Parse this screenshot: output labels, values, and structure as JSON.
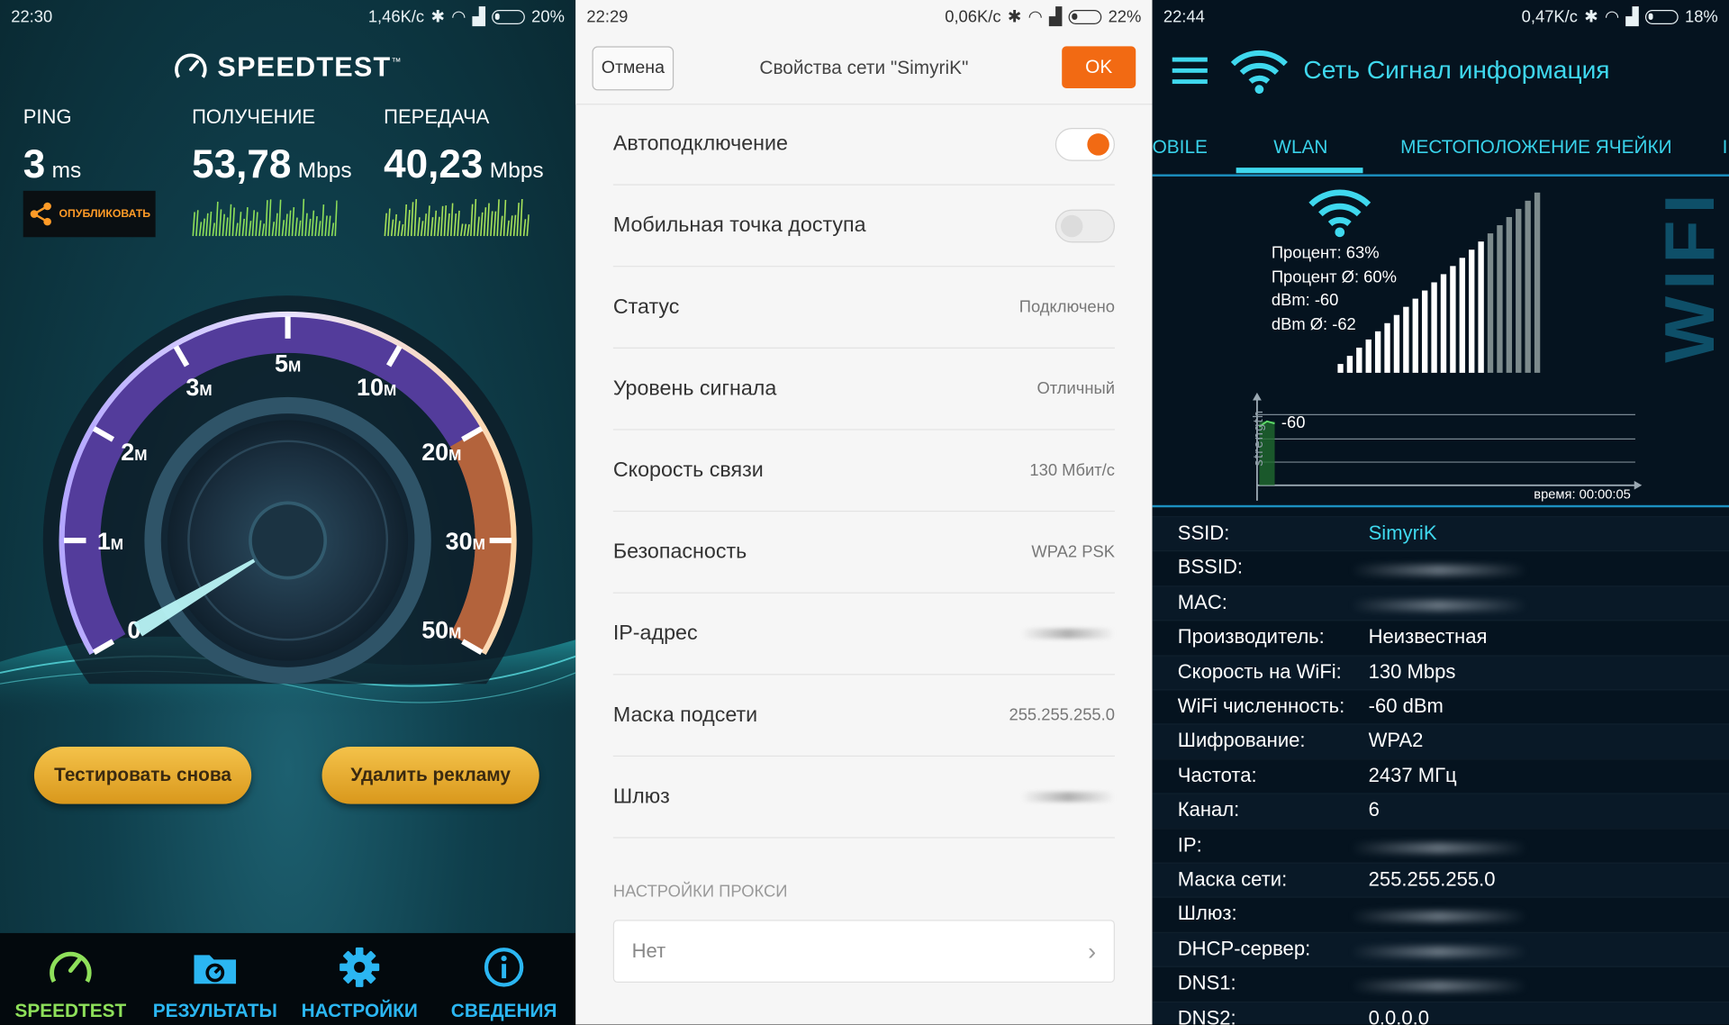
{
  "speedtest": {
    "status": {
      "time": "22:30",
      "speed": "1,46K/с",
      "battery": "20%",
      "battery_level": 0.2
    },
    "logo": "SPEEDTEST",
    "logo_tm": "™",
    "ping": {
      "label": "PING",
      "value": "3",
      "unit": "ms"
    },
    "download": {
      "label": "ПОЛУЧЕНИЕ",
      "value": "53,78",
      "unit": "Mbps"
    },
    "upload": {
      "label": "ПЕРЕДАЧА",
      "value": "40,23",
      "unit": "Mbps"
    },
    "share_label": "ОПУБЛИКОВАТЬ",
    "gauge_ticks": [
      {
        "num": "0",
        "unit": ""
      },
      {
        "num": "1",
        "unit": "M"
      },
      {
        "num": "2",
        "unit": "M"
      },
      {
        "num": "3",
        "unit": "M"
      },
      {
        "num": "5",
        "unit": "M"
      },
      {
        "num": "10",
        "unit": "M"
      },
      {
        "num": "20",
        "unit": "M"
      },
      {
        "num": "30",
        "unit": "M"
      },
      {
        "num": "50",
        "unit": "M"
      }
    ],
    "btn_retest": "Тестировать снова",
    "btn_remove_ads": "Удалить рекламу",
    "nav": [
      {
        "label": "SPEEDTEST",
        "color": "#8ee05a",
        "icon": "speedometer-icon"
      },
      {
        "label": "РЕЗУЛЬТАТЫ",
        "color": "#2bb6f2",
        "icon": "folder-icon"
      },
      {
        "label": "НАСТРОЙКИ",
        "color": "#2bb6f2",
        "icon": "gear-icon"
      },
      {
        "label": "СВЕДЕНИЯ",
        "color": "#2bb6f2",
        "icon": "info-icon"
      }
    ],
    "colors": {
      "accent_green": "#8ee05a",
      "accent_blue": "#2bb6f2",
      "button_gold": "#e6ad33"
    }
  },
  "network_props": {
    "status": {
      "time": "22:29",
      "speed": "0,06K/с",
      "battery": "22%",
      "battery_level": 0.22
    },
    "cancel": "Отмена",
    "title": "Свойства сети \"SimyriK\"",
    "ok": "OK",
    "rows": [
      {
        "label": "Автоподключение",
        "toggle": true
      },
      {
        "label": "Мобильная точка доступа",
        "toggle": false
      },
      {
        "label": "Статус",
        "value": "Подключено"
      },
      {
        "label": "Уровень сигнала",
        "value": "Отличный"
      },
      {
        "label": "Скорость связи",
        "value": "130 Мбит/с"
      },
      {
        "label": "Безопасность",
        "value": "WPA2 PSK"
      },
      {
        "label": "IP-адрес",
        "blurred": true
      },
      {
        "label": "Маска подсети",
        "value": "255.255.255.0"
      },
      {
        "label": "Шлюз",
        "blurred": true
      }
    ],
    "proxy_section": "НАСТРОЙКИ ПРОКСИ",
    "proxy_value": "Нет",
    "colors": {
      "accent": "#f26a13"
    }
  },
  "signal_info": {
    "status": {
      "time": "22:44",
      "speed": "0,47K/с",
      "battery": "18%",
      "battery_level": 0.18
    },
    "title": "Сеть Сигнал информация",
    "tabs": [
      "OBILE",
      "WLAN",
      "МЕСТОПОЛОЖЕНИЕ ЯЧЕЙКИ",
      "I"
    ],
    "active_tab": "WLAN",
    "stats": [
      "Процент: 63%",
      "Процент Ø: 60%",
      "dBm: -60",
      "dBm Ø: -62"
    ],
    "signal_percent": 63,
    "watermark": "WIFI",
    "graph": {
      "ylabel": "strength",
      "value_label": "-60",
      "time_label": "время: 00:00:05"
    },
    "info": [
      {
        "k": "SSID:",
        "v": "SimyriK",
        "accent": true
      },
      {
        "k": "BSSID:",
        "blurred": true
      },
      {
        "k": "MAC:",
        "blurred": true
      },
      {
        "k": "Производитель:",
        "v": "Неизвестная"
      },
      {
        "k": "Скорость на WiFi:",
        "v": "130 Mbps"
      },
      {
        "k": "WiFi численность:",
        "v": "-60 dBm"
      },
      {
        "k": "Шифрование:",
        "v": "WPA2"
      },
      {
        "k": "Частота:",
        "v": "2437 МГц"
      },
      {
        "k": "Канал:",
        "v": "6"
      },
      {
        "k": "IP:",
        "blurred": true
      },
      {
        "k": "Маска сети:",
        "v": "255.255.255.0"
      },
      {
        "k": "Шлюз:",
        "blurred": true
      },
      {
        "k": "DHCP-сервер:",
        "blurred": true
      },
      {
        "k": "DNS1:",
        "blurred": true
      },
      {
        "k": "DNS2:",
        "v": "0.0.0.0"
      }
    ],
    "colors": {
      "accent": "#3fd8ee",
      "background": "#05131f"
    }
  }
}
